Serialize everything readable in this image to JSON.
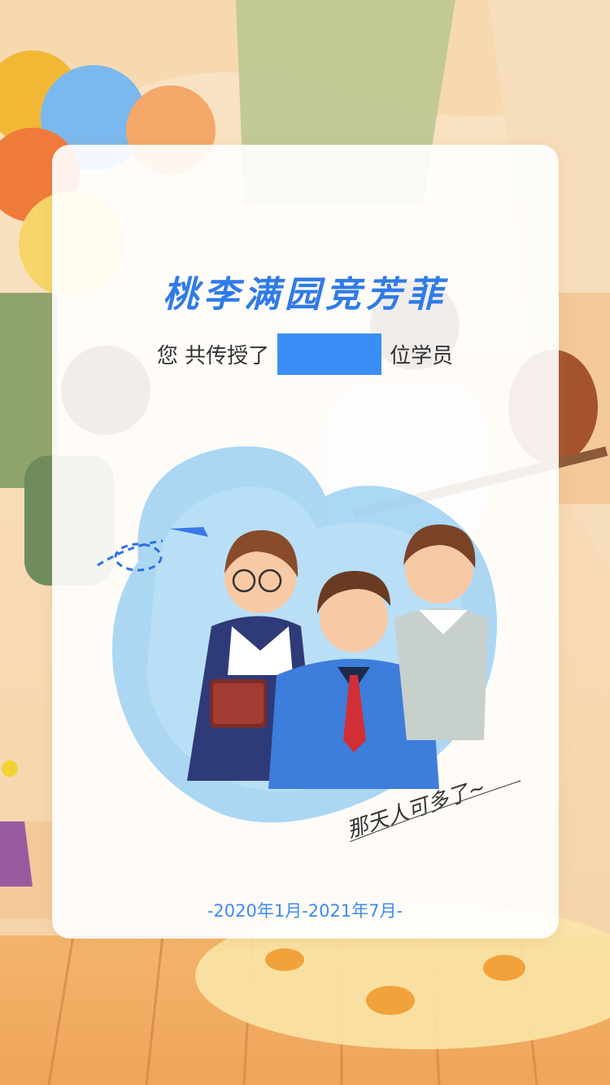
{
  "card": {
    "title": "桃李满园竞芳菲",
    "count_prefix": "您 共传授了",
    "count_value": "",
    "count_suffix": "位学员",
    "caption": "那天人可多了~",
    "date_range": "-2020年1月-2021年7月-"
  },
  "colors": {
    "accent": "#3A8EF6",
    "title": "#2F7BE8",
    "text": "#333333"
  }
}
